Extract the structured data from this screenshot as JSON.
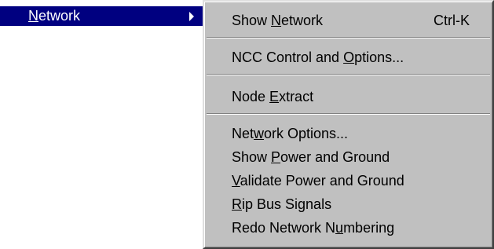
{
  "parent_menu": {
    "label_pre": "",
    "label_mnemonic": "N",
    "label_post": "etwork",
    "submenu_arrow_icon": "triangle-right-icon",
    "highlight_color": "#000080"
  },
  "submenu": {
    "background_color": "#c0c0c0",
    "groups": [
      {
        "items": [
          {
            "pre": "Show ",
            "mnemonic": "N",
            "post": "etwork",
            "shortcut": "Ctrl-K"
          }
        ]
      },
      {
        "items": [
          {
            "pre": "NCC Control and ",
            "mnemonic": "O",
            "post": "ptions..."
          }
        ]
      },
      {
        "items": [
          {
            "pre": "Node ",
            "mnemonic": "E",
            "post": "xtract"
          }
        ]
      },
      {
        "items": [
          {
            "pre": "Net",
            "mnemonic": "w",
            "post": "ork Options..."
          },
          {
            "pre": "Show ",
            "mnemonic": "P",
            "post": "ower and Ground"
          },
          {
            "pre": "",
            "mnemonic": "V",
            "post": "alidate Power and Ground"
          },
          {
            "pre": "",
            "mnemonic": "R",
            "post": "ip Bus Signals"
          },
          {
            "pre": "Redo Network N",
            "mnemonic": "u",
            "post": "mbering"
          }
        ]
      }
    ]
  }
}
